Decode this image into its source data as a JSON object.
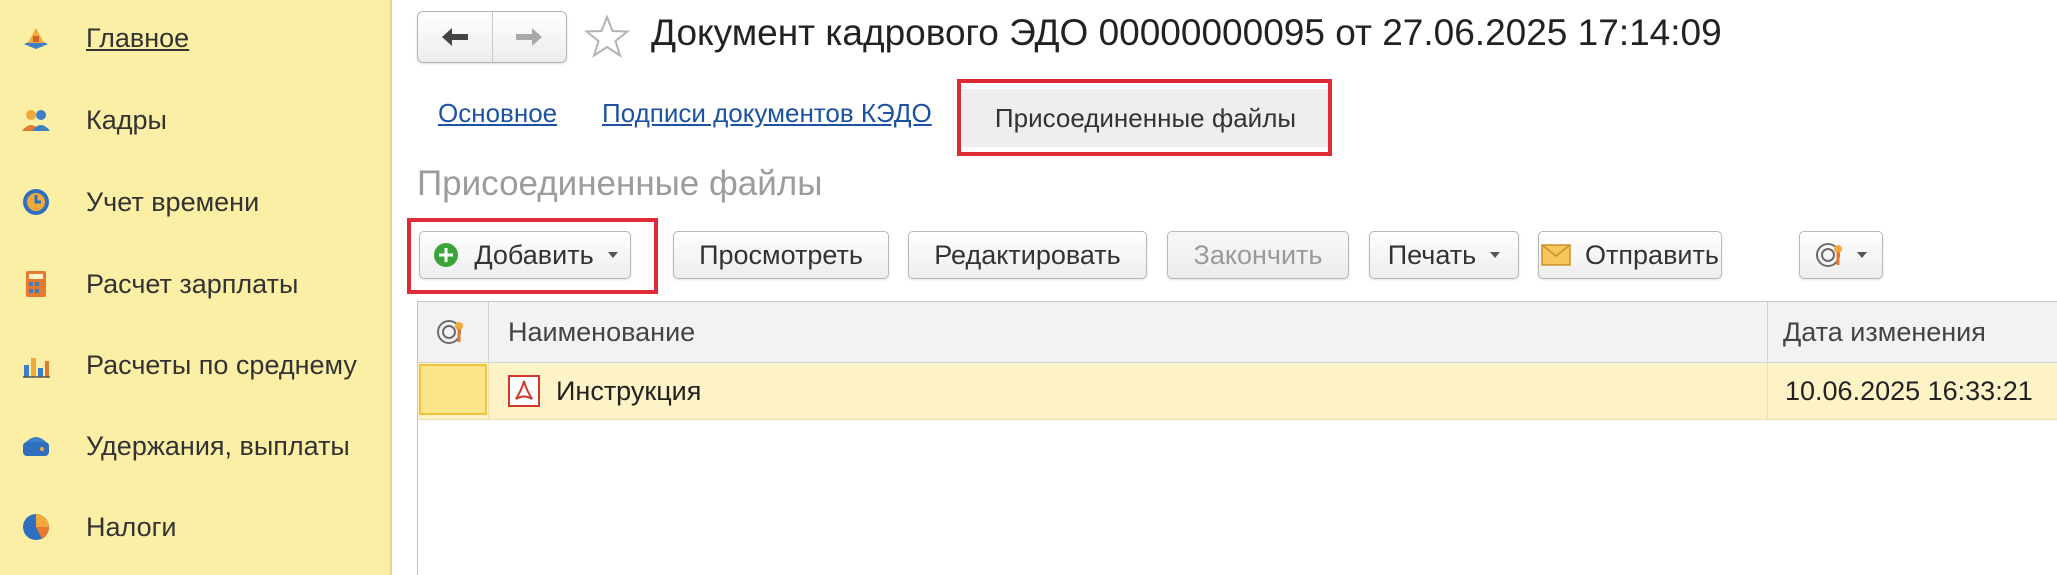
{
  "sidebar": {
    "items": [
      {
        "label": "Главное",
        "icon": "home-icon"
      },
      {
        "label": "Кадры",
        "icon": "people-icon"
      },
      {
        "label": "Учет времени",
        "icon": "clock-icon"
      },
      {
        "label": "Расчет зарплаты",
        "icon": "calculator-icon"
      },
      {
        "label": "Расчеты по среднему",
        "icon": "bar-chart-icon"
      },
      {
        "label": "Удержания, выплаты",
        "icon": "wallet-icon"
      },
      {
        "label": "Налоги",
        "icon": "pie-chart-icon"
      }
    ]
  },
  "header": {
    "title": "Документ кадрового ЭДО 00000000095 от 27.06.2025 17:14:09"
  },
  "tabs": [
    {
      "label": "Основное"
    },
    {
      "label": "Подписи документов КЭДО"
    },
    {
      "label": "Присоединенные файлы"
    }
  ],
  "section": {
    "title": "Присоединенные файлы"
  },
  "toolbar": {
    "add": "Добавить",
    "view": "Просмотреть",
    "edit": "Редактировать",
    "finish": "Закончить",
    "print": "Печать",
    "send": "Отправить"
  },
  "table": {
    "columns": [
      "Наименование",
      "Дата изменения"
    ],
    "rows": [
      {
        "name": "Инструкция",
        "modified": "10.06.2025 16:33:21",
        "icon": "pdf-icon"
      }
    ]
  },
  "colors": {
    "sidebar_bg": "#fbeea5",
    "highlight": "#e02a36",
    "link": "#1d52a3",
    "selected_row": "#fdf3c6"
  }
}
